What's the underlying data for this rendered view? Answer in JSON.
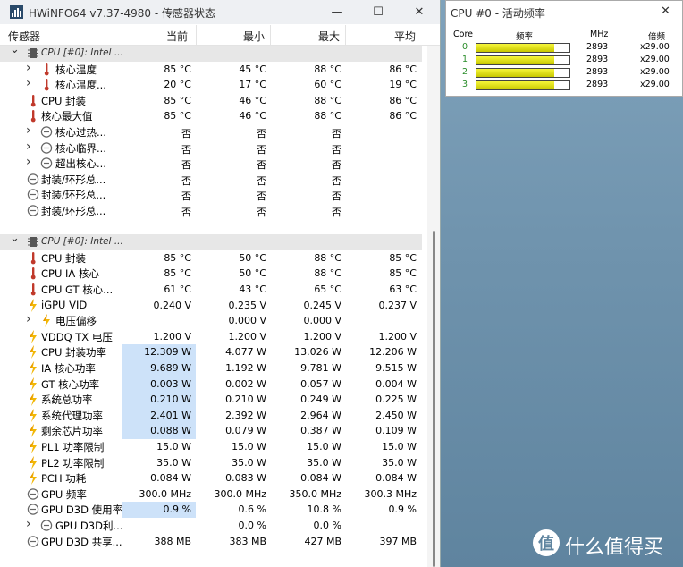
{
  "main_window": {
    "title": "HWiNFO64 v7.37-4980 - 传感器状态",
    "columns": [
      "传感器",
      "当前",
      "最小",
      "最大",
      "平均"
    ],
    "rows": [
      {
        "type": "group",
        "label": "CPU [#0]: Intel ...",
        "chev": "v",
        "icon": "cpu-chip-icon"
      },
      {
        "type": "item",
        "label": "核心温度",
        "chev": ">",
        "icon": "thermometer-icon",
        "indent": 2,
        "cur": "85 °C",
        "min": "45 °C",
        "max": "88 °C",
        "avg": "86 °C"
      },
      {
        "type": "item",
        "label": "核心温度...",
        "chev": ">",
        "icon": "thermometer-icon",
        "indent": 2,
        "cur": "20 °C",
        "min": "17 °C",
        "max": "60 °C",
        "avg": "19 °C"
      },
      {
        "type": "item",
        "label": "CPU 封装",
        "icon": "thermometer-icon",
        "indent": 1,
        "cur": "85 °C",
        "min": "46 °C",
        "max": "88 °C",
        "avg": "86 °C"
      },
      {
        "type": "item",
        "label": "核心最大值",
        "icon": "thermometer-icon",
        "indent": 1,
        "cur": "85 °C",
        "min": "46 °C",
        "max": "88 °C",
        "avg": "86 °C"
      },
      {
        "type": "item",
        "label": "核心过热...",
        "chev": ">",
        "icon": "clock-icon",
        "indent": 2,
        "cur": "否",
        "min": "否",
        "max": "否",
        "avg": ""
      },
      {
        "type": "item",
        "label": "核心临界...",
        "chev": ">",
        "icon": "clock-icon",
        "indent": 2,
        "cur": "否",
        "min": "否",
        "max": "否",
        "avg": ""
      },
      {
        "type": "item",
        "label": "超出核心...",
        "chev": ">",
        "icon": "clock-icon",
        "indent": 2,
        "cur": "否",
        "min": "否",
        "max": "否",
        "avg": ""
      },
      {
        "type": "item",
        "label": "封装/环形总...",
        "icon": "clock-icon",
        "indent": 1,
        "cur": "否",
        "min": "否",
        "max": "否",
        "avg": ""
      },
      {
        "type": "item",
        "label": "封装/环形总...",
        "icon": "clock-icon",
        "indent": 1,
        "cur": "否",
        "min": "否",
        "max": "否",
        "avg": ""
      },
      {
        "type": "item",
        "label": "封装/环形总...",
        "icon": "clock-icon",
        "indent": 1,
        "cur": "否",
        "min": "否",
        "max": "否",
        "avg": ""
      },
      {
        "type": "blank"
      },
      {
        "type": "group",
        "label": "CPU [#0]: Intel ...",
        "chev": "v",
        "icon": "cpu-chip-icon"
      },
      {
        "type": "item",
        "label": "CPU 封装",
        "icon": "thermometer-icon",
        "indent": 1,
        "cur": "85 °C",
        "min": "50 °C",
        "max": "88 °C",
        "avg": "85 °C"
      },
      {
        "type": "item",
        "label": "CPU IA 核心",
        "icon": "thermometer-icon",
        "indent": 1,
        "cur": "85 °C",
        "min": "50 °C",
        "max": "88 °C",
        "avg": "85 °C"
      },
      {
        "type": "item",
        "label": "CPU GT 核心...",
        "icon": "thermometer-icon",
        "indent": 1,
        "cur": "61 °C",
        "min": "43 °C",
        "max": "65 °C",
        "avg": "63 °C"
      },
      {
        "type": "item",
        "label": "iGPU VID",
        "icon": "bolt-icon",
        "indent": 1,
        "cur": "0.240 V",
        "min": "0.235 V",
        "max": "0.245 V",
        "avg": "0.237 V"
      },
      {
        "type": "item",
        "label": "电压偏移",
        "chev": ">",
        "icon": "bolt-icon",
        "indent": 2,
        "cur": "",
        "min": "0.000 V",
        "max": "0.000 V",
        "avg": ""
      },
      {
        "type": "item",
        "label": "VDDQ TX 电压",
        "icon": "bolt-icon",
        "indent": 1,
        "cur": "1.200 V",
        "min": "1.200 V",
        "max": "1.200 V",
        "avg": "1.200 V"
      },
      {
        "type": "item",
        "label": "CPU 封装功率",
        "icon": "bolt-icon",
        "indent": 1,
        "cur": "12.309 W",
        "min": "4.077 W",
        "max": "13.026 W",
        "avg": "12.206 W",
        "hl": true
      },
      {
        "type": "item",
        "label": "IA 核心功率",
        "icon": "bolt-icon",
        "indent": 1,
        "cur": "9.689 W",
        "min": "1.192 W",
        "max": "9.781 W",
        "avg": "9.515 W",
        "hl": true
      },
      {
        "type": "item",
        "label": "GT 核心功率",
        "icon": "bolt-icon",
        "indent": 1,
        "cur": "0.003 W",
        "min": "0.002 W",
        "max": "0.057 W",
        "avg": "0.004 W",
        "hl": true
      },
      {
        "type": "item",
        "label": "系统总功率",
        "icon": "bolt-icon",
        "indent": 1,
        "cur": "0.210 W",
        "min": "0.210 W",
        "max": "0.249 W",
        "avg": "0.225 W",
        "hl": true
      },
      {
        "type": "item",
        "label": "系统代理功率",
        "icon": "bolt-icon",
        "indent": 1,
        "cur": "2.401 W",
        "min": "2.392 W",
        "max": "2.964 W",
        "avg": "2.450 W",
        "hl": true
      },
      {
        "type": "item",
        "label": "剩余芯片功率",
        "icon": "bolt-icon",
        "indent": 1,
        "cur": "0.088 W",
        "min": "0.079 W",
        "max": "0.387 W",
        "avg": "0.109 W",
        "hl": true
      },
      {
        "type": "item",
        "label": "PL1 功率限制",
        "icon": "bolt-icon",
        "indent": 1,
        "cur": "15.0 W",
        "min": "15.0 W",
        "max": "15.0 W",
        "avg": "15.0 W"
      },
      {
        "type": "item",
        "label": "PL2 功率限制",
        "icon": "bolt-icon",
        "indent": 1,
        "cur": "35.0 W",
        "min": "35.0 W",
        "max": "35.0 W",
        "avg": "35.0 W"
      },
      {
        "type": "item",
        "label": "PCH 功耗",
        "icon": "bolt-icon",
        "indent": 1,
        "cur": "0.084 W",
        "min": "0.083 W",
        "max": "0.084 W",
        "avg": "0.084 W"
      },
      {
        "type": "item",
        "label": "GPU 频率",
        "icon": "clock-icon",
        "indent": 1,
        "cur": "300.0 MHz",
        "min": "300.0 MHz",
        "max": "350.0 MHz",
        "avg": "300.3 MHz"
      },
      {
        "type": "item",
        "label": "GPU D3D 使用率",
        "icon": "clock-icon",
        "indent": 1,
        "cur": "0.9 %",
        "min": "0.6 %",
        "max": "10.8 %",
        "avg": "0.9 %",
        "hl": true
      },
      {
        "type": "item",
        "label": "GPU D3D利...",
        "chev": ">",
        "icon": "clock-icon",
        "indent": 2,
        "cur": "",
        "min": "0.0 %",
        "max": "0.0 %",
        "avg": ""
      },
      {
        "type": "item",
        "label": "GPU D3D 共享...",
        "icon": "clock-icon",
        "indent": 1,
        "cur": "388 MB",
        "min": "383 MB",
        "max": "427 MB",
        "avg": "397 MB"
      }
    ]
  },
  "freq_window": {
    "title": "CPU #0 - 活动频率",
    "headers": {
      "core": "Core",
      "freq": "频率",
      "mhz": "MHz",
      "mult": "倍频"
    },
    "cores": [
      {
        "id": "0",
        "mhz": "2893",
        "mult": "x29.00",
        "fill_ratio": 0.84
      },
      {
        "id": "1",
        "mhz": "2893",
        "mult": "x29.00",
        "fill_ratio": 0.84
      },
      {
        "id": "2",
        "mhz": "2893",
        "mult": "x29.00",
        "fill_ratio": 0.84
      },
      {
        "id": "3",
        "mhz": "2893",
        "mult": "x29.00",
        "fill_ratio": 0.84
      }
    ]
  },
  "watermark": {
    "logo": "值",
    "text": "什么值得买"
  },
  "colors": {
    "highlight": "#cde2f9",
    "bar_fill": "#e6e600",
    "core_green": "#2a8d2a"
  }
}
